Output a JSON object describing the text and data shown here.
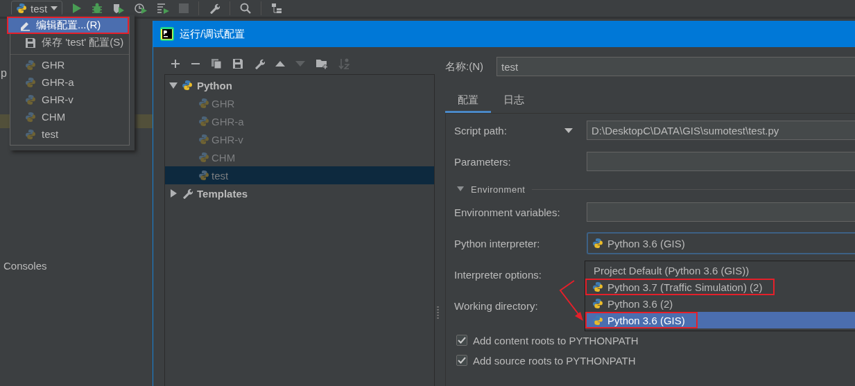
{
  "toolbar": {
    "run_config": "test"
  },
  "side_panel": {
    "cut_text": "p",
    "consoles": "Consoles"
  },
  "run_menu": {
    "actions": [
      {
        "label": "编辑配置...(R)",
        "kind": "edit",
        "selected": true,
        "marked": true
      },
      {
        "label": "保存 'test' 配置(S)",
        "kind": "save",
        "selected": false,
        "marked": false
      }
    ],
    "configs": [
      {
        "label": "GHR",
        "dimmed": true
      },
      {
        "label": "GHR-a",
        "dimmed": true
      },
      {
        "label": "GHR-v",
        "dimmed": true
      },
      {
        "label": "CHM",
        "dimmed": true
      },
      {
        "label": "test",
        "dimmed": true
      }
    ]
  },
  "dialog": {
    "title": "运行/调试配置",
    "tree": [
      {
        "label": "Python",
        "kind": "python",
        "expanded": true,
        "children": [
          {
            "label": "GHR",
            "selected": false,
            "dimmed": true
          },
          {
            "label": "GHR-a",
            "selected": false,
            "dimmed": true
          },
          {
            "label": "GHR-v",
            "selected": false,
            "dimmed": true
          },
          {
            "label": "CHM",
            "selected": false,
            "dimmed": true
          },
          {
            "label": "test",
            "selected": true,
            "dimmed": true
          }
        ]
      },
      {
        "label": "Templates",
        "kind": "templates",
        "expanded": false
      }
    ],
    "name": {
      "label": "名称:(N)",
      "value": "test"
    },
    "tabs": [
      {
        "label": "配置",
        "selected": true
      },
      {
        "label": "日志",
        "selected": false
      }
    ],
    "rows": [
      {
        "kind": "path",
        "label": "Script path:",
        "value": "D:\\DesktopC\\DATA\\GIS\\sumotest\\test.py"
      },
      {
        "kind": "text",
        "label": "Parameters:"
      },
      {
        "kind": "section",
        "label": "Environment",
        "expanded": true
      },
      {
        "kind": "text",
        "label": "Environment variables:"
      },
      {
        "kind": "combo",
        "label": "Python interpreter:",
        "value": "Python 3.6 (GIS)"
      },
      {
        "kind": "plain",
        "label": "Interpreter options:"
      },
      {
        "kind": "plain",
        "label": "Working directory:"
      },
      {
        "kind": "checkbox",
        "label": "Add content roots to PYTHONPATH",
        "checked": true
      },
      {
        "kind": "checkbox",
        "label": "Add source roots to PYTHONPATH",
        "checked": true
      }
    ],
    "interpreter_popup": [
      {
        "label": "Project Default (Python 3.6 (GIS))",
        "kind": "default",
        "selected": false,
        "marked": false
      },
      {
        "label": "Python 3.7 (Traffic Simulation) (2)",
        "kind": "interpreter",
        "selected": false,
        "marked": true
      },
      {
        "label": "Python 3.6 (2)",
        "kind": "interpreter",
        "selected": false,
        "marked": false
      },
      {
        "label": "Python 3.6 (GIS)",
        "kind": "interpreter",
        "selected": true,
        "marked": true
      }
    ]
  }
}
